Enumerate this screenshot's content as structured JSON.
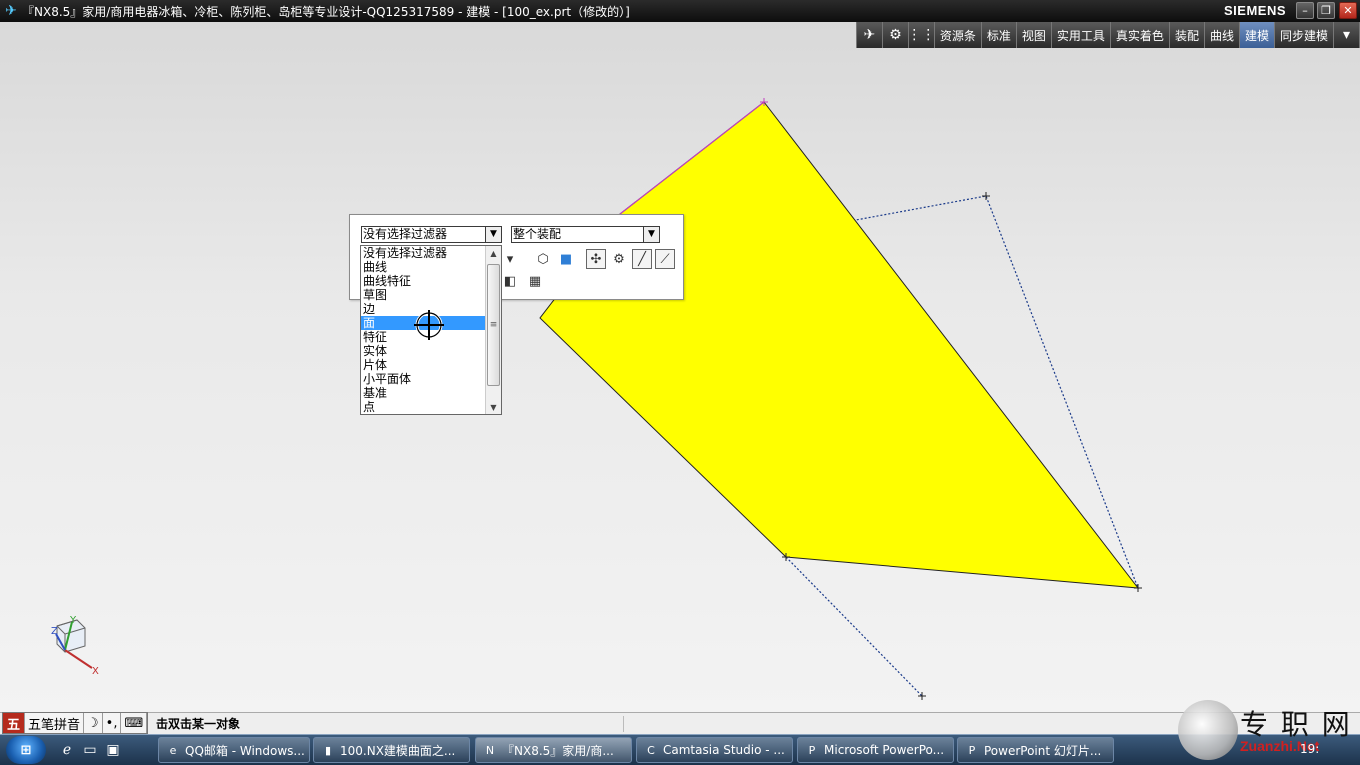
{
  "window": {
    "title": "『NX8.5』家用/商用电器冰箱、冷柜、陈列柜、岛柜等专业设计-QQ125317589 - 建模 - [100_ex.prt（修改的）]",
    "brand": "SIEMENS",
    "minimize": "–",
    "restore": "❐",
    "close": "✕"
  },
  "toolbar": {
    "tabs": [
      {
        "label": "资源条"
      },
      {
        "label": "标准"
      },
      {
        "label": "视图"
      },
      {
        "label": "实用工具"
      },
      {
        "label": "真实着色"
      },
      {
        "label": "装配"
      },
      {
        "label": "曲线"
      },
      {
        "label": "建模",
        "active": true
      },
      {
        "label": "同步建模"
      }
    ],
    "more": "▾"
  },
  "filter_bar": {
    "type_filter": "没有选择过滤器",
    "scope": "整个装配"
  },
  "dropdown": {
    "items": [
      "没有选择过滤器",
      "曲线",
      "曲线特征",
      "草图",
      "边",
      "面",
      "特征",
      "实体",
      "片体",
      "小平面体",
      "基准",
      "点"
    ],
    "selected_index": 5
  },
  "triad": {
    "x": "X",
    "y": "Y",
    "z": "Z"
  },
  "status": {
    "ime_name": "五笔拼音",
    "prompt": "击双击某一对象"
  },
  "taskbar": {
    "tasks": [
      {
        "label": "QQ邮箱 - Windows...",
        "icon": "e"
      },
      {
        "label": "100.NX建模曲面之...",
        "icon": "▮"
      },
      {
        "label": "『NX8.5』家用/商...",
        "icon": "N",
        "active": true
      },
      {
        "label": "Camtasia Studio - ...",
        "icon": "C"
      },
      {
        "label": "Microsoft PowerPo...",
        "icon": "P"
      },
      {
        "label": "PowerPoint 幻灯片...",
        "icon": "P"
      }
    ],
    "clock": "19:"
  },
  "watermark": {
    "text": "专 职 网",
    "url": "Zuanzhi.Net"
  },
  "colors": {
    "face": "#ffff00",
    "selection": "#3399ff"
  }
}
